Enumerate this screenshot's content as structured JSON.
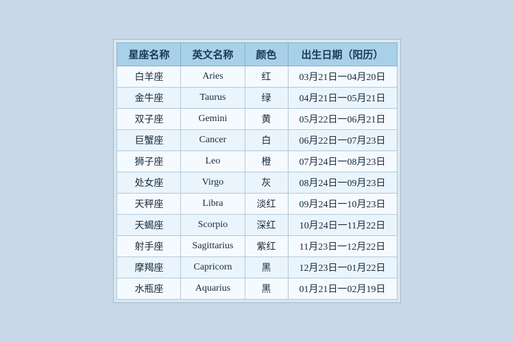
{
  "table": {
    "headers": [
      "星座名称",
      "英文名称",
      "颜色",
      "出生日期（阳历）"
    ],
    "rows": [
      {
        "chinese": "白羊座",
        "english": "Aries",
        "color": "红",
        "dates": "03月21日一04月20日"
      },
      {
        "chinese": "金牛座",
        "english": "Taurus",
        "color": "绿",
        "dates": "04月21日一05月21日"
      },
      {
        "chinese": "双子座",
        "english": "Gemini",
        "color": "黄",
        "dates": "05月22日一06月21日"
      },
      {
        "chinese": "巨蟹座",
        "english": "Cancer",
        "color": "白",
        "dates": "06月22日一07月23日"
      },
      {
        "chinese": "狮子座",
        "english": "Leo",
        "color": "橙",
        "dates": "07月24日一08月23日"
      },
      {
        "chinese": "处女座",
        "english": "Virgo",
        "color": "灰",
        "dates": "08月24日一09月23日"
      },
      {
        "chinese": "天秤座",
        "english": "Libra",
        "color": "淡红",
        "dates": "09月24日一10月23日"
      },
      {
        "chinese": "天蝎座",
        "english": "Scorpio",
        "color": "深红",
        "dates": "10月24日一11月22日"
      },
      {
        "chinese": "射手座",
        "english": "Sagittarius",
        "color": "紫红",
        "dates": "11月23日一12月22日"
      },
      {
        "chinese": "摩羯座",
        "english": "Capricorn",
        "color": "黑",
        "dates": "12月23日一01月22日"
      },
      {
        "chinese": "水瓶座",
        "english": "Aquarius",
        "color": "黑",
        "dates": "01月21日一02月19日"
      }
    ]
  }
}
